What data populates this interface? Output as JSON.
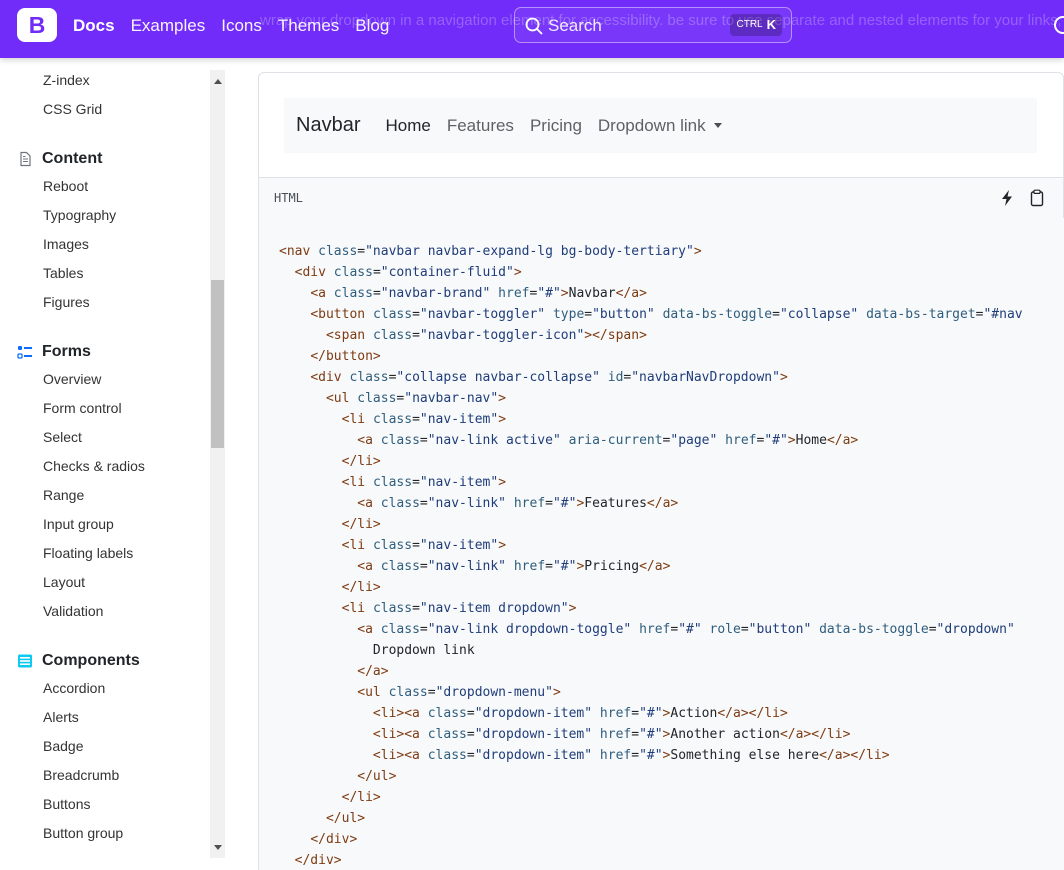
{
  "topbar": {
    "logo_letter": "B",
    "ghost_text": "wrap your dropdown in a navigation element for accessibility. be sure to use separate and nested elements for your links, as shown below.",
    "links": [
      {
        "label": "Docs",
        "active": true
      },
      {
        "label": "Examples"
      },
      {
        "label": "Icons"
      },
      {
        "label": "Themes"
      },
      {
        "label": "Blog"
      }
    ],
    "search": {
      "placeholder": "Search",
      "kbd_mod": "CTRL",
      "kbd_key": "K"
    }
  },
  "sidebar": {
    "top_items": [
      "Z-index",
      "CSS Grid"
    ],
    "groups": [
      {
        "title": "Content",
        "icon": "file-text-icon",
        "items": [
          "Reboot",
          "Typography",
          "Images",
          "Tables",
          "Figures"
        ]
      },
      {
        "title": "Forms",
        "icon": "ui-checks-icon",
        "items": [
          "Overview",
          "Form control",
          "Select",
          "Checks & radios",
          "Range",
          "Input group",
          "Floating labels",
          "Layout",
          "Validation"
        ]
      },
      {
        "title": "Components",
        "icon": "menu-button-icon",
        "items": [
          "Accordion",
          "Alerts",
          "Badge",
          "Breadcrumb",
          "Buttons",
          "Button group"
        ]
      }
    ]
  },
  "example": {
    "brand": "Navbar",
    "links": [
      "Home",
      "Features",
      "Pricing",
      "Dropdown link"
    ]
  },
  "code": {
    "language": "HTML"
  },
  "colors": {
    "brand": "#712cf9",
    "code_bg": "#f8f9fa"
  }
}
